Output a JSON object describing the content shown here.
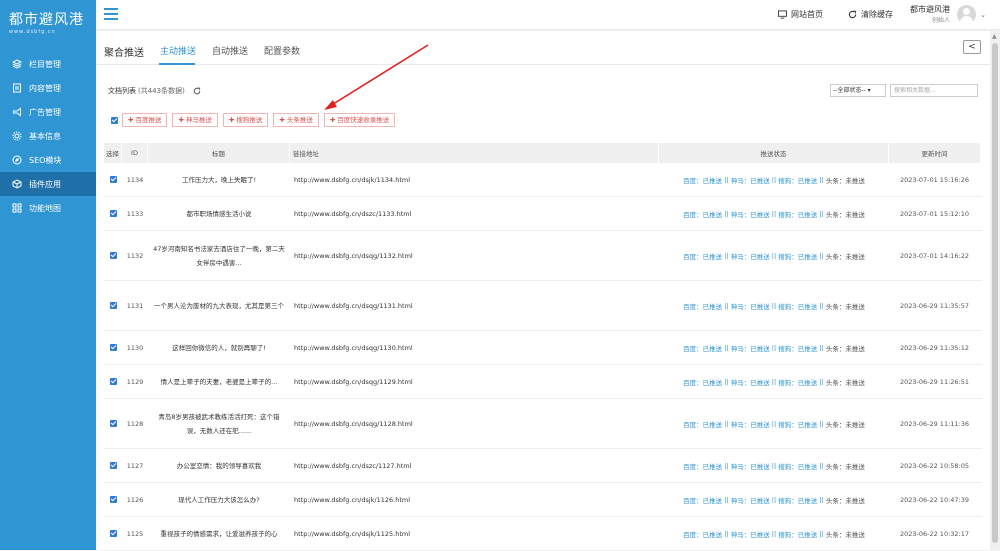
{
  "sidebar": {
    "logo_title": "都市避风港",
    "logo_sub": "www.dsbfg.cn",
    "items": [
      {
        "label": "栏目管理",
        "icon": "layers-icon"
      },
      {
        "label": "内容管理",
        "icon": "document-icon"
      },
      {
        "label": "广告管理",
        "icon": "megaphone-icon"
      },
      {
        "label": "基本信息",
        "icon": "gear-icon"
      },
      {
        "label": "SEO模块",
        "icon": "compass-icon"
      },
      {
        "label": "插件应用",
        "icon": "cube-icon",
        "active": true
      },
      {
        "label": "功能地图",
        "icon": "grid-icon"
      }
    ]
  },
  "topbar": {
    "site_home": "网站首页",
    "clear_cache": "清除缓存",
    "user_name": "都市避风港",
    "user_role": "创始人"
  },
  "tabs": {
    "main": "聚合推送",
    "items": [
      "主动推送",
      "自动推送",
      "配置参数"
    ],
    "active": "主动推送",
    "back_label": "<"
  },
  "list": {
    "title": "文档列表",
    "count": "(共443条数据)",
    "status_select": "--全部状态-- ▾",
    "search_placeholder": "搜索相关数据..."
  },
  "push_buttons": [
    "百度推送",
    "神马推送",
    "搜狗推送",
    "头条推送",
    "百度快速收录推送"
  ],
  "table": {
    "headers": [
      "选择",
      "ID",
      "标题",
      "链接地址",
      "推送状态",
      "更新时间"
    ],
    "rows": [
      {
        "id": "1134",
        "title": "工作压力大，晚上失眠了!",
        "url": "http://www.dsbfg.cn/dsjk/1134.html",
        "time": "2023-07-01 15:16:26",
        "height": 34
      },
      {
        "id": "1133",
        "title": "都市职场情感生活小说",
        "url": "http://www.dsbfg.cn/dszc/1133.html",
        "time": "2023-07-01 15:12:10",
        "height": 34
      },
      {
        "id": "1132",
        "title": "47岁河南知名书法家去酒店住了一晚，第二天女伴房中遇害...",
        "url": "http://www.dsbfg.cn/dsqg/1132.html",
        "time": "2023-07-01 14:16:22",
        "height": 50
      },
      {
        "id": "1131",
        "title": "一个男人沦为废材的九大表现，尤其是第三个",
        "url": "http://www.dsbfg.cn/dsqg/1131.html",
        "time": "2023-06-29 11:35:57",
        "height": 50
      },
      {
        "id": "1130",
        "title": "这样回你微信的人，就别再聊了!",
        "url": "http://www.dsbfg.cn/dsqg/1130.html",
        "time": "2023-06-29 11:35:12",
        "height": 34
      },
      {
        "id": "1129",
        "title": "情人是上辈子的夫妻，老婆是上辈子的...",
        "url": "http://www.dsbfg.cn/dsqg/1129.html",
        "time": "2023-06-29 11:26:51",
        "height": 34
      },
      {
        "id": "1128",
        "title": "青岛8岁男孩被武术教练活活打死：这个错误，无数人还在犯......",
        "url": "http://www.dsbfg.cn/dsqg/1128.html",
        "time": "2023-06-29 11:11:36",
        "height": 50
      },
      {
        "id": "1127",
        "title": "办公室恋情：我的领导喜欢我",
        "url": "http://www.dsbfg.cn/dszc/1127.html",
        "time": "2023-06-22 10:58:05",
        "height": 34
      },
      {
        "id": "1126",
        "title": "现代人工作压力大该怎么办?",
        "url": "http://www.dsbfg.cn/dsjk/1126.html",
        "time": "2023-06-22 10:47:39",
        "height": 34
      },
      {
        "id": "1125",
        "title": "重视孩子的情感需求，让爱滋养孩子的心",
        "url": "http://www.dsbfg.cn/dsjk/1125.html",
        "time": "2023-06-22 10:32:17",
        "height": 34
      }
    ],
    "status": {
      "baidu": "百度：已推送",
      "shenma": "神马：已推送",
      "sogou": "搜狗：已推送",
      "toutiao": "头条：未推送",
      "sep": "||"
    }
  },
  "colors": {
    "sidebar": "#2f95d3",
    "sidebar_active": "#1f6fa9",
    "accent": "#2f95d3",
    "push_button_text": "#d9534f",
    "arrow": "#e02020"
  }
}
